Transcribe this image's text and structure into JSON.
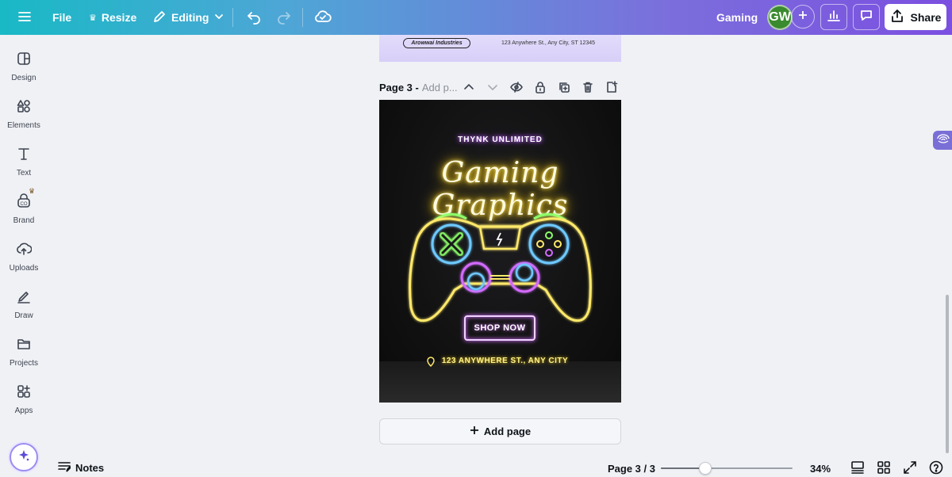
{
  "topbar": {
    "menu_icon": "hamburger-icon",
    "file_label": "File",
    "resize_label": "Resize",
    "editing_label": "Editing",
    "design_title": "Gaming",
    "avatar_initials": "GW",
    "share_label": "Share",
    "colors": {
      "gradient_start": "#19b9c6",
      "gradient_end": "#7b4fe0"
    }
  },
  "sidebar": {
    "items": [
      {
        "label": "Design",
        "icon": "layout-icon"
      },
      {
        "label": "Elements",
        "icon": "shapes-icon"
      },
      {
        "label": "Text",
        "icon": "text-icon"
      },
      {
        "label": "Brand",
        "icon": "brand-icon"
      },
      {
        "label": "Uploads",
        "icon": "cloud-upload-icon"
      },
      {
        "label": "Draw",
        "icon": "pen-icon"
      },
      {
        "label": "Projects",
        "icon": "folder-icon"
      },
      {
        "label": "Apps",
        "icon": "apps-icon"
      }
    ]
  },
  "prev_page": {
    "company": "Arowwai Industries",
    "address": "123 Anywhere St., Any City, ST 12345"
  },
  "page_header": {
    "title": "Page 3 -",
    "subtitle": "Add p..."
  },
  "poster": {
    "brand": "THYNK UNLIMITED",
    "title": "Gaming Graphics",
    "button": "SHOP NOW",
    "address": "123 ANYWHERE ST., ANY CITY"
  },
  "add_page_label": "Add page",
  "bottombar": {
    "notes_label": "Notes",
    "page_count": "Page 3 / 3",
    "zoom_label": "34%",
    "zoom_level": 0.34
  }
}
